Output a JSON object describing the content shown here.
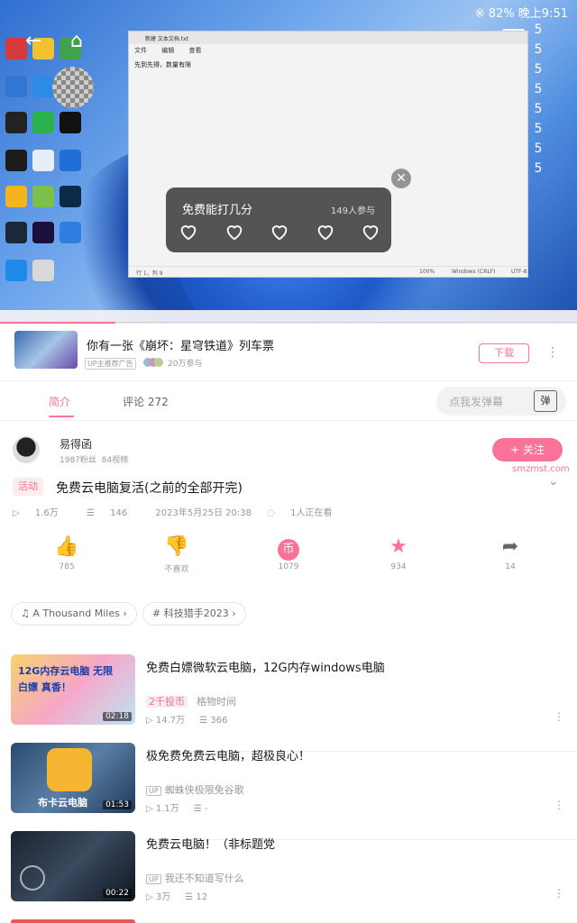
{
  "status_bar": {
    "right": "※ 82% 晚上9:51"
  },
  "player": {
    "danmaku_column": [
      "5",
      "5",
      "5",
      "5",
      "5",
      "5",
      "5",
      "5"
    ],
    "notepad": {
      "tab_title": "新建 文本文档.txt",
      "menu": [
        "文件",
        "编辑",
        "查看"
      ],
      "content": "先到先得，数量有限",
      "status_left": "行 1，列 9",
      "status_zoom": "100%",
      "status_eol": "Windows (CRLF)",
      "status_enc": "UTF-8"
    },
    "rating": {
      "question": "免费能打几分",
      "count": "149人参与"
    },
    "progress_percent": 20
  },
  "ad": {
    "title": "你有一张《崩坏：星穹铁道》列车票",
    "badge": "UP主推荐广告",
    "participants": "20万参与",
    "download": "下载"
  },
  "tabs": {
    "intro": "简介",
    "comments": "评论 272",
    "danmaku_placeholder": "点我发弹幕",
    "danmaku_btn": "弹"
  },
  "uploader": {
    "name": "易得函",
    "fans": "1987粉丝",
    "videos": "84视频",
    "follow": "+ 关注",
    "watermark": "smzmst.com"
  },
  "video": {
    "tag": "活动",
    "title": "免费云电脑复活(之前的全部开完)",
    "views": "1.6万",
    "danmaku": "146",
    "date": "2023年5月25日 20:38",
    "watching": "1人正在看"
  },
  "actions": [
    {
      "name": "like",
      "count": "785",
      "color": "#fb7299"
    },
    {
      "name": "dislike",
      "count": "不喜欢",
      "color": "#61666d"
    },
    {
      "name": "coin",
      "count": "1079",
      "color": "#fb7299"
    },
    {
      "name": "favorite",
      "count": "934",
      "color": "#fb7299"
    },
    {
      "name": "share",
      "count": "14",
      "color": "#61666d"
    }
  ],
  "pills": {
    "music": "A Thousand Miles",
    "event": "科技猎手2023"
  },
  "recommendations": [
    {
      "title": "免费白嫖微软云电脑，12G内存windows电脑",
      "thumb_text": "12G内存云电脑 无限白嫖 真香！",
      "duration": "02:18",
      "badge": "2千投币",
      "author": "格物时间",
      "views": "14.7万",
      "danmaku": "366"
    },
    {
      "title": "极免费免费云电脑，超极良心！",
      "thumb_text": "布卡云电脑",
      "duration": "01:53",
      "badge": "UP",
      "author": "蜘蛛侠极限免谷歌",
      "views": "1.1万",
      "danmaku": "-"
    },
    {
      "title": "免费云电脑！（非标题党",
      "thumb_text": "",
      "duration": "00:22",
      "badge": "UP",
      "author": "我还不知道写什么",
      "views": "3万",
      "danmaku": "12"
    }
  ]
}
